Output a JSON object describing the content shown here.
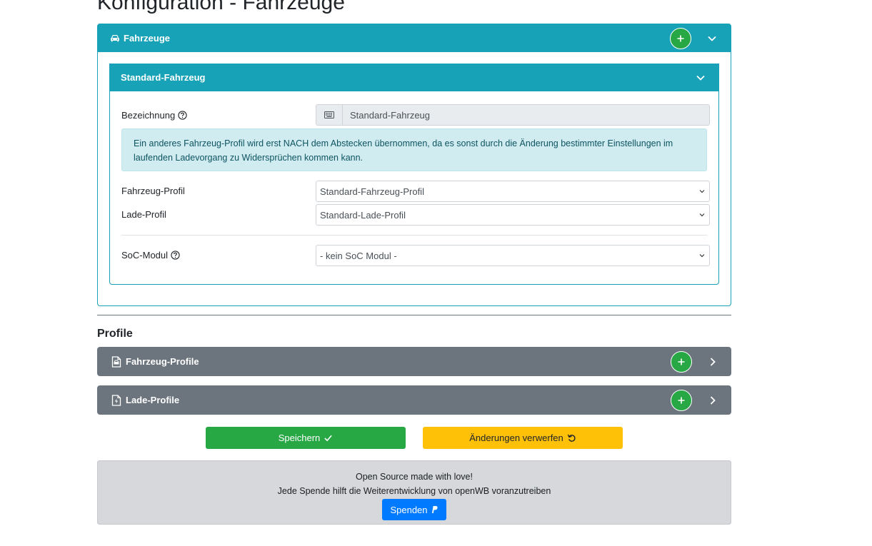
{
  "page": {
    "title": "Konfiguration - Fahrzeuge"
  },
  "vehicles_card": {
    "title": "Fahrzeuge",
    "icon": "car-icon"
  },
  "vehicle": {
    "title": "Standard-Fahrzeug",
    "name_label": "Bezeichnung",
    "name_value": "Standard-Fahrzeug",
    "name_icon": "keyboard-icon",
    "info_text": "Ein anderes Fahrzeug-Profil wird erst NACH dem Abstecken übernommen, da es sonst durch die Änderung bestimmter Einstellungen im laufenden Ladevorgang zu Widersprüchen kommen kann.",
    "vehicle_profile_label": "Fahrzeug-Profil",
    "vehicle_profile_value": "Standard-Fahrzeug-Profil",
    "charge_profile_label": "Lade-Profil",
    "charge_profile_value": "Standard-Lade-Profil",
    "soc_label": "SoC-Modul",
    "soc_value": "- kein SoC Modul -"
  },
  "profiles": {
    "heading": "Profile",
    "vehicle_profiles": {
      "title": "Fahrzeug-Profile",
      "icon": "file-car-icon"
    },
    "charge_profiles": {
      "title": "Lade-Profile",
      "icon": "file-charge-icon"
    }
  },
  "actions": {
    "save_label": "Speichern",
    "discard_label": "Änderungen verwerfen"
  },
  "footer": {
    "line1": "Open Source made with love!",
    "line2": "Jede Spende hilft die Weiterentwicklung von openWB voranzutreiben",
    "donate_label": "Spenden"
  },
  "colors": {
    "teal": "#17a2b8",
    "gray": "#6c757d",
    "green": "#28a745",
    "yellow": "#ffc107",
    "blue": "#007bff",
    "info_bg": "#d1ecf1"
  }
}
